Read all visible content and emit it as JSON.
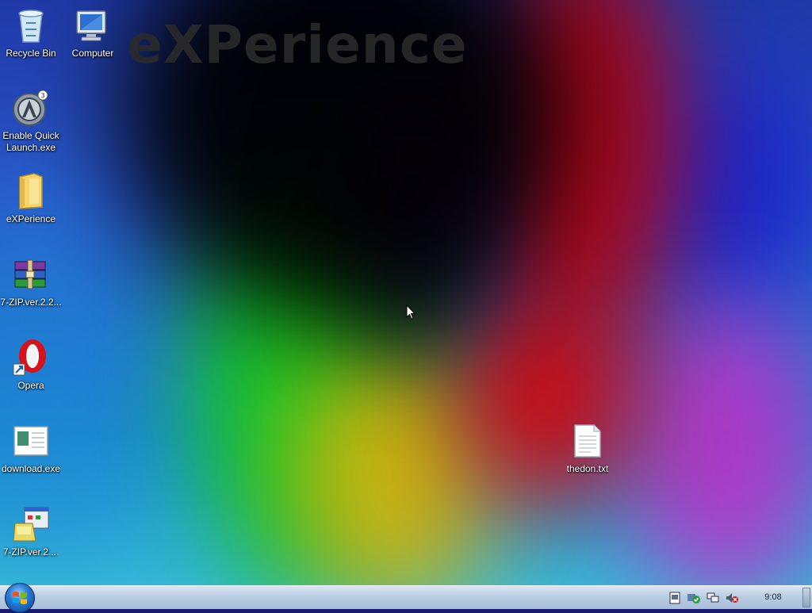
{
  "desktop": {
    "brand_text": "eXPerience",
    "icons": [
      {
        "name": "Recycle Bin",
        "icon": "recycle-bin-icon"
      },
      {
        "name": "Computer",
        "icon": "computer-icon"
      },
      {
        "name": "Enable Quick Launch.exe",
        "icon": "app-launcher-icon"
      },
      {
        "name": "eXPerience",
        "icon": "folder-icon"
      },
      {
        "name": "7-ZIP.ver.2.2...",
        "icon": "winrar-archive-icon"
      },
      {
        "name": "Opera",
        "icon": "opera-icon"
      },
      {
        "name": "download.exe",
        "icon": "download-exe-icon"
      },
      {
        "name": "7-ZIP.ver.2....",
        "icon": "installer-icon"
      },
      {
        "name": "thedon.txt",
        "icon": "text-file-icon"
      }
    ]
  },
  "taskbar": {
    "start_button": "start-orb-icon",
    "tray_icons": [
      "network-drive-icon",
      "security-center-icon",
      "network-icon",
      "volume-muted-icon"
    ],
    "clock": "9:08"
  }
}
